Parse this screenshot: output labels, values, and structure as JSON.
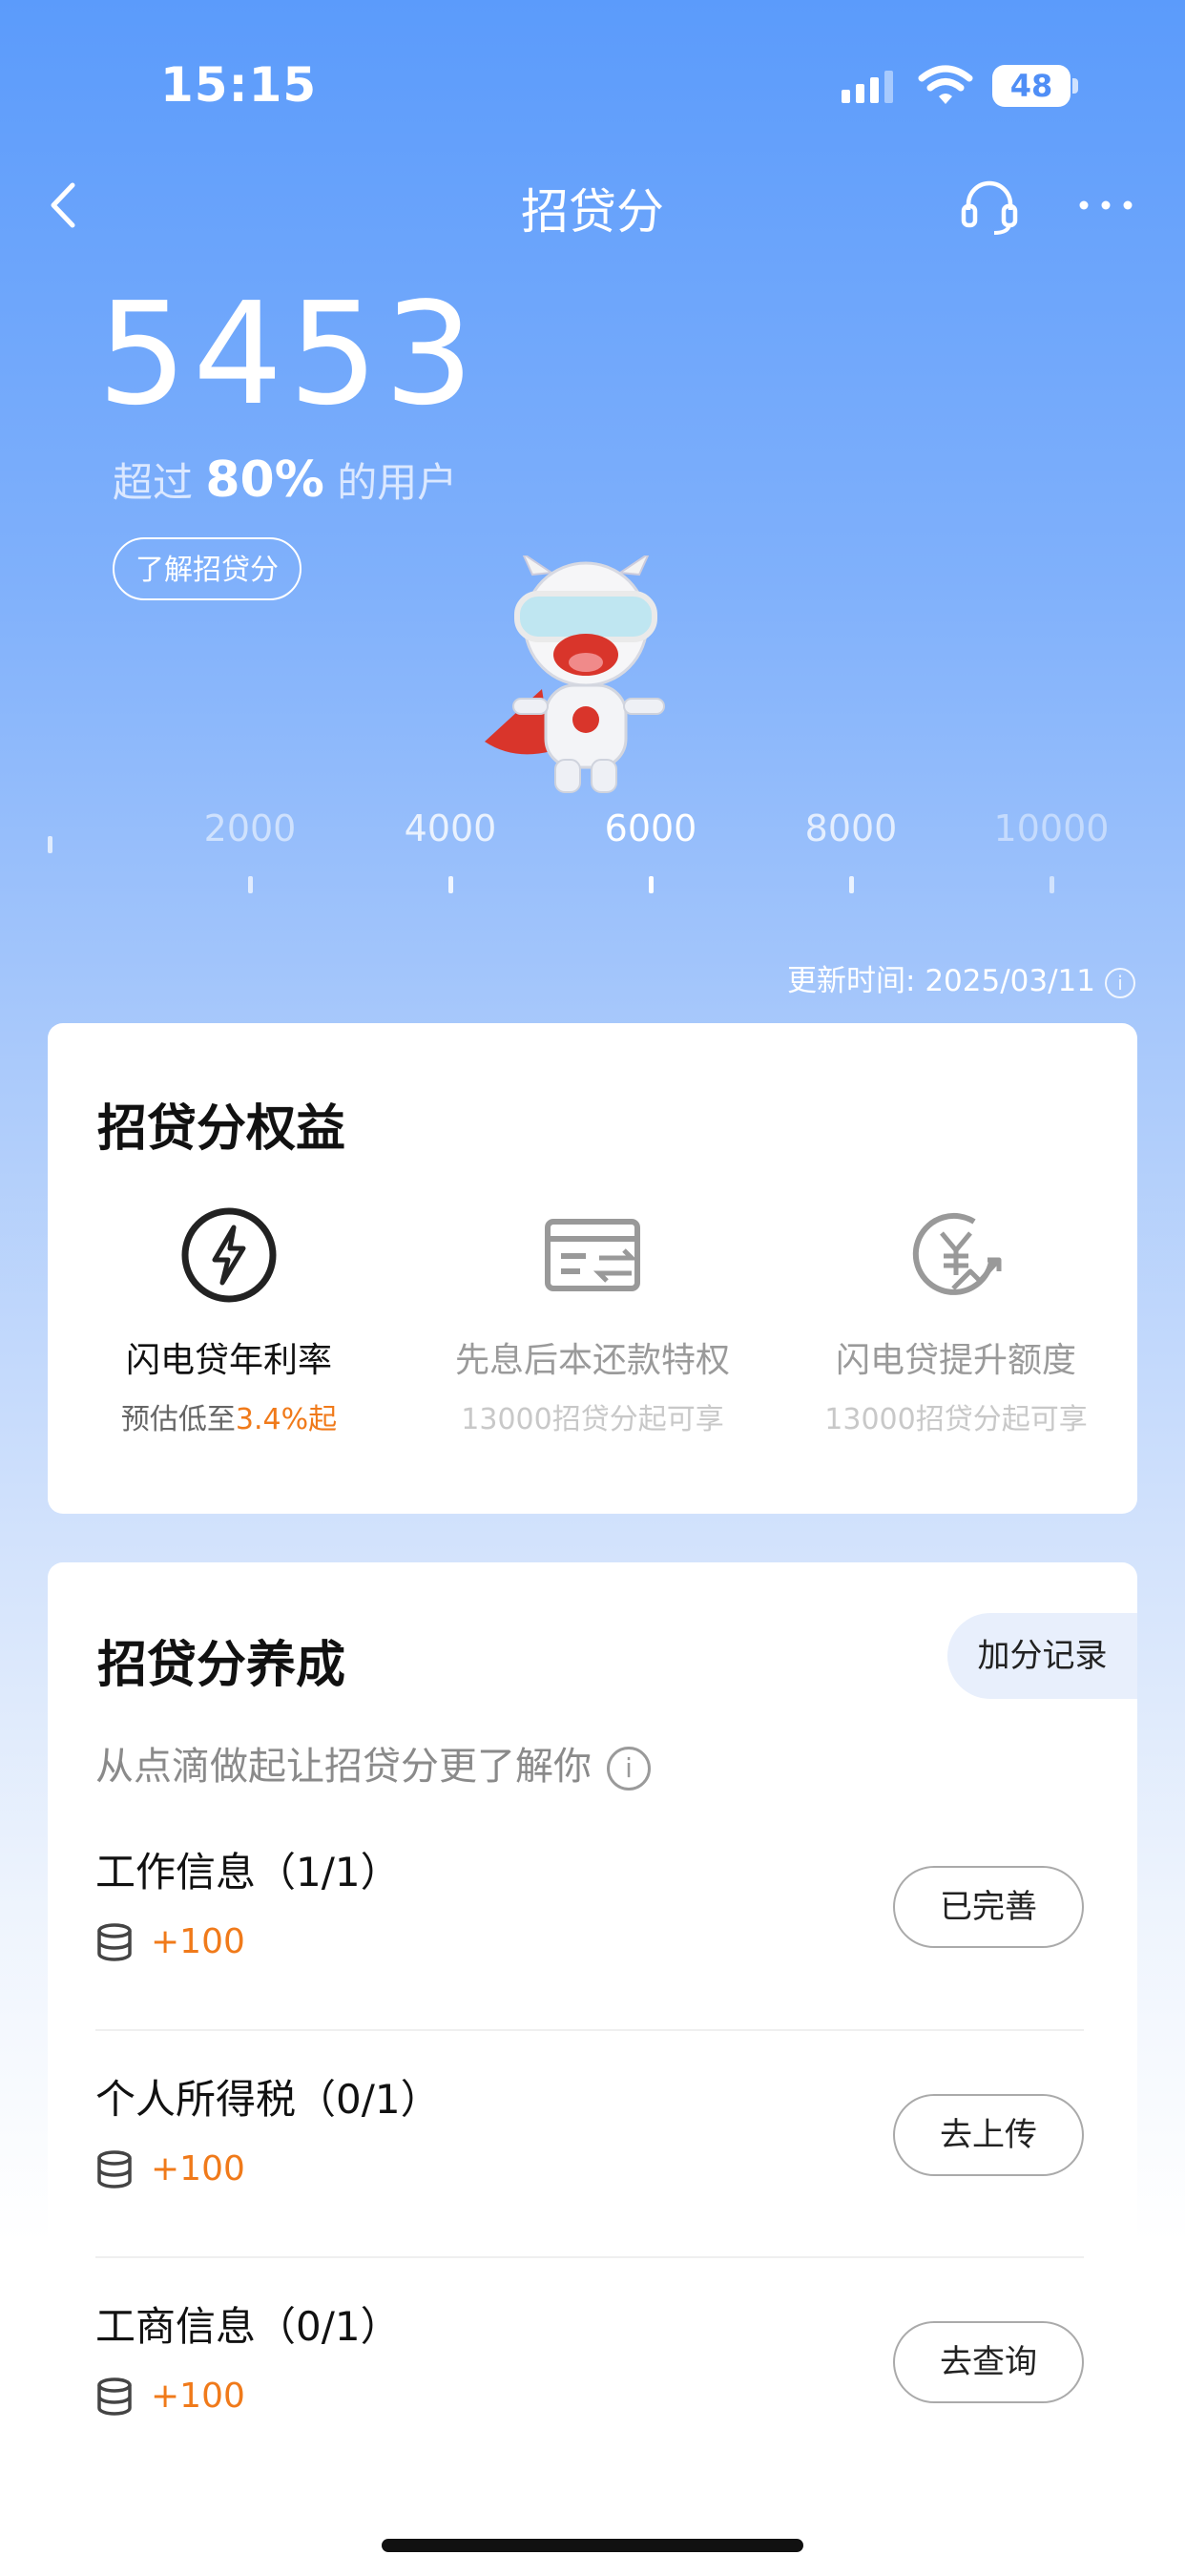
{
  "status": {
    "time": "15:15",
    "battery": "48"
  },
  "nav": {
    "title": "招贷分"
  },
  "score": {
    "value": "5453",
    "exceed_prefix": "超过",
    "exceed_percent": "80%",
    "exceed_suffix": "的用户",
    "learn_label": "了解招贷分"
  },
  "ruler": {
    "labels": [
      "2000",
      "4000",
      "6000",
      "8000",
      "10000"
    ]
  },
  "update": {
    "text": "更新时间: 2025/03/11"
  },
  "benefits": {
    "title": "招贷分权益",
    "items": [
      {
        "icon": "lightning-icon",
        "name": "闪电贷年利率",
        "sub_prefix": "预估低至",
        "sub_highlight": "3.4%起"
      },
      {
        "icon": "card-transfer-icon",
        "name": "先息后本还款特权",
        "sub": "13000招贷分起可享"
      },
      {
        "icon": "yuan-rise-icon",
        "name": "闪电贷提升额度",
        "sub": "13000招贷分起可享"
      }
    ]
  },
  "cultivate": {
    "title": "招贷分养成",
    "record_label": "加分记录",
    "subtitle": "从点滴做起让招贷分更了解你",
    "tasks": [
      {
        "name": "工作信息（1/1）",
        "points": "+100",
        "button": "已完善"
      },
      {
        "name": "个人所得税（0/1）",
        "points": "+100",
        "button": "去上传"
      },
      {
        "name": "工商信息（0/1）",
        "points": "+100",
        "button": "去查询"
      }
    ]
  },
  "colors": {
    "accent_orange": "#f07a1a",
    "bg_blue": "#5b9bfb"
  }
}
